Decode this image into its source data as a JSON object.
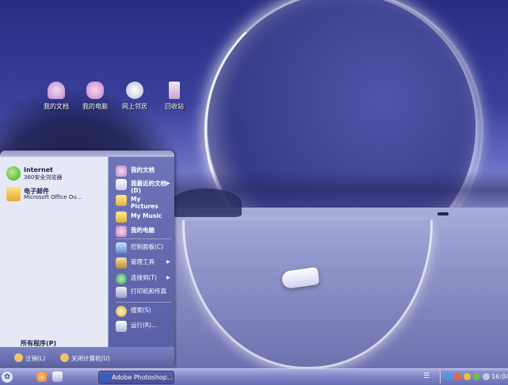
{
  "desktop_icons": [
    {
      "label": "我的文档",
      "icon": "documents-folder-icon"
    },
    {
      "label": "我的电脑",
      "icon": "computer-icon"
    },
    {
      "label": "网上邻居",
      "icon": "network-icon"
    },
    {
      "label": "回收站",
      "icon": "recycle-bin-icon"
    }
  ],
  "start_menu": {
    "pinned": [
      {
        "title": "Internet",
        "subtitle": "360安全浏览器",
        "icon": "browser-icon"
      },
      {
        "title": "电子邮件",
        "subtitle": "Microsoft Office Ou...",
        "icon": "email-icon"
      }
    ],
    "all_programs": "所有程序(P)",
    "right": [
      {
        "label": "我的文档",
        "icon": "documents-folder-icon",
        "bold": true
      },
      {
        "label": "我最近的文档(D)",
        "icon": "recent-documents-icon",
        "bold": true,
        "submenu": true
      },
      {
        "label": "My Pictures",
        "icon": "pictures-folder-icon",
        "bold": true
      },
      {
        "label": "My Music",
        "icon": "music-folder-icon",
        "bold": true
      },
      {
        "label": "我的电脑",
        "icon": "computer-icon",
        "bold": true
      },
      {
        "label": "控制面板(C)",
        "icon": "control-panel-icon"
      },
      {
        "label": "管理工具",
        "icon": "admin-tools-icon",
        "submenu": true
      },
      {
        "label": "连接到(T)",
        "icon": "connect-icon",
        "submenu": true
      },
      {
        "label": "打印机和传真",
        "icon": "printer-icon"
      },
      {
        "label": "搜索(S)",
        "icon": "search-icon"
      },
      {
        "label": "运行(R)...",
        "icon": "run-icon"
      }
    ],
    "logoff": "注销(L)",
    "shutdown": "关闭计算机(U)"
  },
  "taskbar": {
    "task": {
      "label": "Adobe Photoshop...",
      "icon": "photoshop-icon"
    },
    "clock": "16:04"
  },
  "colors": {
    "taskbar": "#7e83c4",
    "start_menu_left": "#e6e8f6",
    "start_menu_right": "#5a5fa6"
  }
}
